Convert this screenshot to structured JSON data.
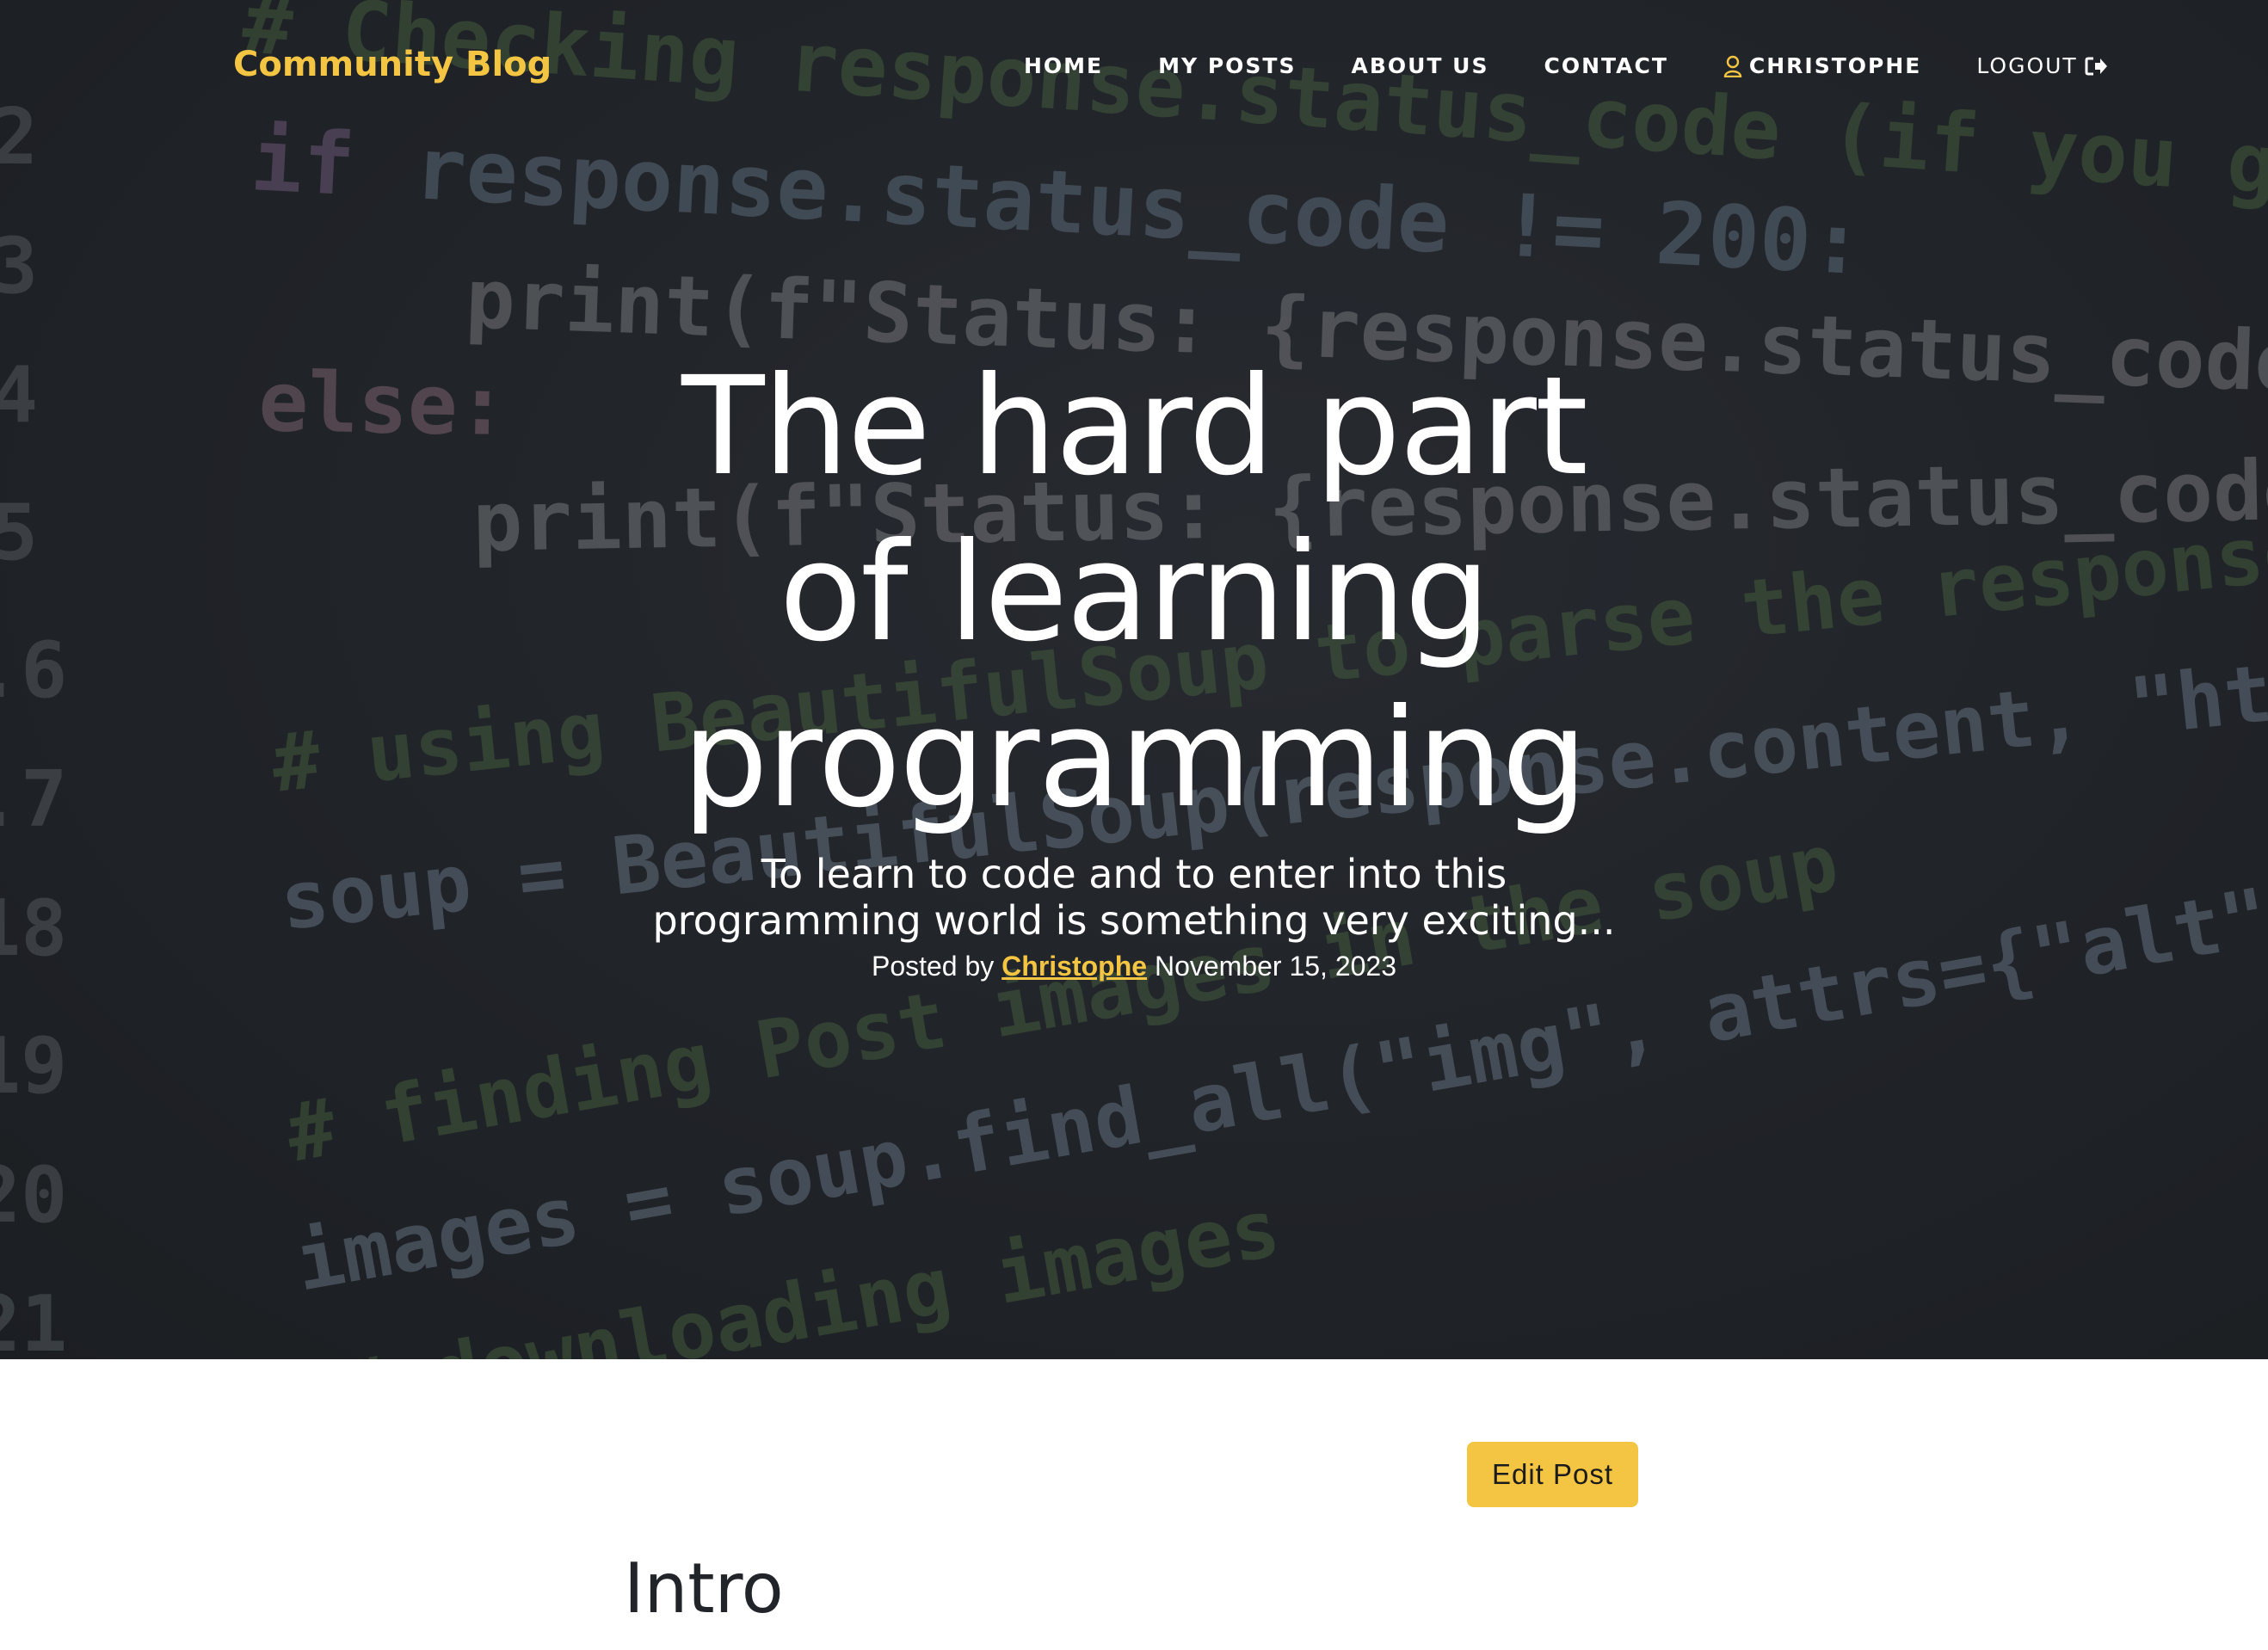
{
  "navbar": {
    "brand": "Community Blog",
    "links": {
      "home": "HOME",
      "my_posts": "MY POSTS",
      "about_us": "ABOUT US",
      "contact": "CONTACT",
      "user": "CHRISTOPHE",
      "logout": "LOGOUT"
    }
  },
  "hero": {
    "title": "The hard part of learning programming",
    "subtitle": "To learn to code and to enter into this programming world is something very exciting...",
    "meta": {
      "posted_by": "Posted by",
      "author": "Christophe",
      "date": "November 15, 2023"
    }
  },
  "content": {
    "edit_button": "Edit Post",
    "section_heading": "Intro"
  },
  "colors": {
    "accent": "#f4c542",
    "hero_bg": "#26292e",
    "text_dark": "#212529"
  }
}
